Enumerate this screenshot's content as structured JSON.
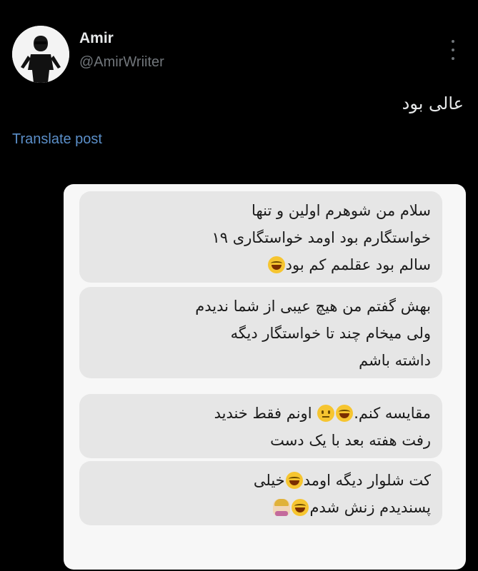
{
  "post": {
    "author_name": "Amir",
    "author_handle": "@AmirWriiter",
    "text": "عالی بود",
    "translate_label": "Translate post",
    "more_icon": "more-vertical-icon"
  },
  "media": {
    "bubbles": [
      {
        "lines": [
          "سلام من شوهرم اولین و تنها",
          "خواستگارم بود اومد خواستگاری ۱۹",
          "سالم بود عقلمم کم بود"
        ]
      },
      {
        "lines": [
          "بهش گفتم من هیچ عیبی از شما ندیدم",
          "ولی میخام چند تا خواستگار دیگه",
          "داشته باشم"
        ]
      },
      {
        "lines": [
          "مقایسه کنم.",
          "اونم فقط خندید",
          "رفت هفته بعد با یک دست"
        ]
      },
      {
        "lines": [
          "کت شلوار دیگه اومد",
          "خیلی",
          "پسندیدم زنش شدم"
        ]
      }
    ]
  }
}
